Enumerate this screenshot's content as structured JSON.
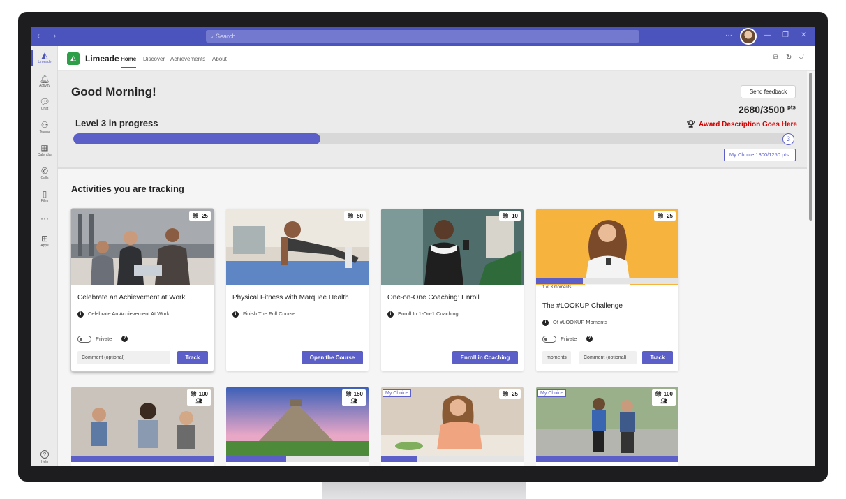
{
  "titlebar": {
    "search_placeholder": "Search",
    "nav_arrows": "‹ ›",
    "window_controls": [
      "···",
      "—",
      "❐",
      "✕"
    ]
  },
  "rail": {
    "items": [
      {
        "label": "Limeade",
        "icon": "limeade-icon",
        "glyph": "◭"
      },
      {
        "label": "Activity",
        "icon": "bell-icon",
        "glyph": "🔔︎"
      },
      {
        "label": "Chat",
        "icon": "chat-icon",
        "glyph": "💬︎"
      },
      {
        "label": "Teams",
        "icon": "teams-icon",
        "glyph": "⚇"
      },
      {
        "label": "Calendar",
        "icon": "calendar-icon",
        "glyph": "▦"
      },
      {
        "label": "Calls",
        "icon": "phone-icon",
        "glyph": "✆"
      },
      {
        "label": "Files",
        "icon": "file-icon",
        "glyph": "▯"
      },
      {
        "label": "",
        "icon": "more-icon",
        "glyph": "···"
      },
      {
        "label": "Apps",
        "icon": "apps-icon",
        "glyph": "⊞"
      }
    ],
    "help": {
      "label": "Help",
      "glyph": "?"
    }
  },
  "header": {
    "app_name": "Limeade",
    "tabs": [
      "Home",
      "Discover",
      "Achievements",
      "About"
    ]
  },
  "hero": {
    "greeting": "Good Morning!",
    "feedback_label": "Send feedback",
    "points": "2680/3500",
    "points_unit": "pts",
    "award": "Award Description Goes Here",
    "level_text": "Level 3 in progress",
    "progress_fraction": 0.345,
    "level_number": "3",
    "my_choice": "My Choice 1300/1250 pts."
  },
  "section_title": "Activities you are tracking",
  "cards": [
    {
      "title": "Celebrate an Achievement at Work",
      "sub": "Celebrate An Achievement At Work",
      "badge": "25",
      "private": "Private",
      "comment": "Comment (optional)",
      "button": "Track"
    },
    {
      "title": "Physical Fitness with Marquee Health",
      "sub": "Finish The Full Course",
      "badge": "50",
      "button": "Open the Course"
    },
    {
      "title": "One-on-One Coaching: Enroll",
      "sub": "Enroll In 1-On-1 Coaching",
      "badge": "10",
      "button": "Enroll in Coaching"
    },
    {
      "title": "The #LOOKUP Challenge",
      "sub": "Of #LOOKUP Moments",
      "badge": "25",
      "moments": "1 of 3 moments",
      "moments_fraction": 0.33,
      "private": "Private",
      "chip": "moments",
      "comment": "Comment (optional)",
      "button": "Track"
    }
  ],
  "row2": [
    {
      "badge": "100",
      "tag": "",
      "progress": 1.0
    },
    {
      "badge": "150",
      "tag": "",
      "progress": 0.42
    },
    {
      "badge": "25",
      "tag": "My Choice",
      "progress": 0.25
    },
    {
      "badge": "100",
      "tag": "My Choice",
      "progress": 1.0
    }
  ],
  "colors": {
    "brand": "#4b53bc",
    "accent": "#5b5fc7",
    "award": "#d40000"
  }
}
